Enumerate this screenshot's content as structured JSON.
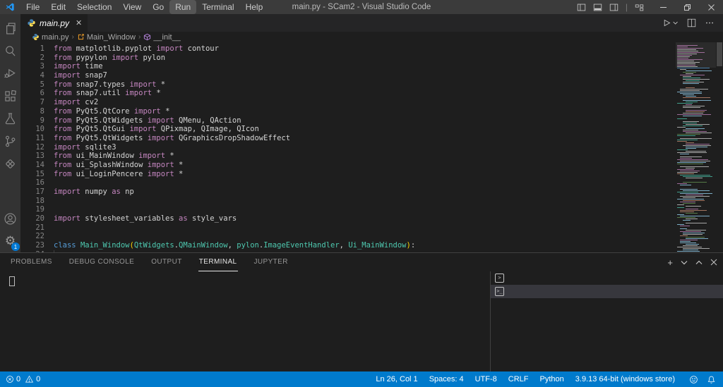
{
  "window": {
    "title": "main.py - SCam2 - Visual Studio Code",
    "menu_items": [
      "File",
      "Edit",
      "Selection",
      "View",
      "Go",
      "Run",
      "Terminal",
      "Help"
    ],
    "active_menu": "Run"
  },
  "activity_bar": {
    "items": [
      "explorer",
      "search",
      "run-and-debug",
      "extensions",
      "testing",
      "source-control",
      "remote-targets"
    ],
    "settings_badge": "1"
  },
  "editor": {
    "tab": {
      "label": "main.py",
      "close": "✕"
    },
    "breadcrumb": [
      {
        "label": "main.py",
        "icon": "python"
      },
      {
        "label": "Main_Window",
        "icon": "class"
      },
      {
        "label": "__init__",
        "icon": "method"
      }
    ],
    "breadcrumb_separator": "›",
    "lines": [
      [
        [
          "k",
          "from"
        ],
        [
          "p",
          " matplotlib.pyplot "
        ],
        [
          "k",
          "import"
        ],
        [
          "p",
          " contour"
        ]
      ],
      [
        [
          "k",
          "from"
        ],
        [
          "p",
          " pypylon "
        ],
        [
          "k",
          "import"
        ],
        [
          "p",
          " pylon"
        ]
      ],
      [
        [
          "k",
          "import"
        ],
        [
          "p",
          " time"
        ]
      ],
      [
        [
          "k",
          "import"
        ],
        [
          "p",
          " snap7"
        ]
      ],
      [
        [
          "k",
          "from"
        ],
        [
          "p",
          " snap7.types "
        ],
        [
          "k",
          "import"
        ],
        [
          "p",
          " *"
        ]
      ],
      [
        [
          "k",
          "from"
        ],
        [
          "p",
          " snap7.util "
        ],
        [
          "k",
          "import"
        ],
        [
          "p",
          " *"
        ]
      ],
      [
        [
          "k",
          "import"
        ],
        [
          "p",
          " cv2"
        ]
      ],
      [
        [
          "k",
          "from"
        ],
        [
          "p",
          " PyQt5.QtCore "
        ],
        [
          "k",
          "import"
        ],
        [
          "p",
          " *"
        ]
      ],
      [
        [
          "k",
          "from"
        ],
        [
          "p",
          " PyQt5.QtWidgets "
        ],
        [
          "k",
          "import"
        ],
        [
          "p",
          " QMenu, QAction"
        ]
      ],
      [
        [
          "k",
          "from"
        ],
        [
          "p",
          " PyQt5.QtGui "
        ],
        [
          "k",
          "import"
        ],
        [
          "p",
          " QPixmap, QImage, QIcon"
        ]
      ],
      [
        [
          "k",
          "from"
        ],
        [
          "p",
          " PyQt5.QtWidgets "
        ],
        [
          "k",
          "import"
        ],
        [
          "p",
          " QGraphicsDropShadowEffect"
        ]
      ],
      [
        [
          "k",
          "import"
        ],
        [
          "p",
          " sqlite3"
        ]
      ],
      [
        [
          "k",
          "from"
        ],
        [
          "p",
          " ui_MainWindow "
        ],
        [
          "k",
          "import"
        ],
        [
          "p",
          " *"
        ]
      ],
      [
        [
          "k",
          "from"
        ],
        [
          "p",
          " ui_SplashWindow "
        ],
        [
          "k",
          "import"
        ],
        [
          "p",
          " *"
        ]
      ],
      [
        [
          "k",
          "from"
        ],
        [
          "p",
          " ui_LoginPencere "
        ],
        [
          "k",
          "import"
        ],
        [
          "p",
          " *"
        ]
      ],
      [],
      [
        [
          "k",
          "import"
        ],
        [
          "p",
          " numpy "
        ],
        [
          "k",
          "as"
        ],
        [
          "p",
          " np"
        ]
      ],
      [],
      [],
      [
        [
          "k",
          "import"
        ],
        [
          "p",
          " stylesheet_variables "
        ],
        [
          "k",
          "as"
        ],
        [
          "p",
          " style_vars"
        ]
      ],
      [],
      [],
      [
        [
          "b",
          "class"
        ],
        [
          "p",
          " "
        ],
        [
          "t",
          "Main_Window"
        ],
        [
          "y",
          "("
        ],
        [
          "t",
          "QtWidgets"
        ],
        [
          "p",
          "."
        ],
        [
          "t",
          "QMainWindow"
        ],
        [
          "p",
          ", "
        ],
        [
          "t",
          "pylon"
        ],
        [
          "p",
          "."
        ],
        [
          "t",
          "ImageEventHandler"
        ],
        [
          "p",
          ", "
        ],
        [
          "t",
          "Ui_MainWindow"
        ],
        [
          "y",
          ")"
        ],
        [
          "p",
          ":"
        ]
      ],
      [
        [
          "g",
          ""
        ]
      ]
    ]
  },
  "panel": {
    "tabs": [
      "PROBLEMS",
      "DEBUG CONSOLE",
      "OUTPUT",
      "TERMINAL",
      "JUPYTER"
    ],
    "active_tab": "TERMINAL",
    "actions": {
      "new": "+",
      "dropdown": "⌄",
      "maximize": "⌃",
      "close": "✕"
    },
    "terminal_list": [
      {
        "icon_glyph": ">",
        "selected": false
      },
      {
        "icon_glyph": ">_",
        "selected": true
      }
    ]
  },
  "status_bar": {
    "errors": "0",
    "warnings": "0",
    "right_items": [
      "Ln 26, Col 1",
      "Spaces: 4",
      "UTF-8",
      "CRLF",
      "Python",
      "3.9.13 64-bit (windows store)"
    ]
  },
  "colors": {
    "statusbar": "#007acc",
    "titlebar": "#3b3b3b",
    "activitybar": "#333333",
    "editor_bg": "#1e1e1e",
    "keyword": "#c586c0",
    "keyword_blue": "#569cd6",
    "type_teal": "#4ec9b0",
    "plain": "#d4d4d4",
    "bracket_gold": "#ffd700"
  },
  "minimap": {
    "rows": 148,
    "import_rows": 16,
    "seed": 42,
    "palette": [
      "#d4d4d4",
      "#9cdcfe",
      "#4ec9b0",
      "#c586c0",
      "#6a9955",
      "#ce9178"
    ]
  }
}
